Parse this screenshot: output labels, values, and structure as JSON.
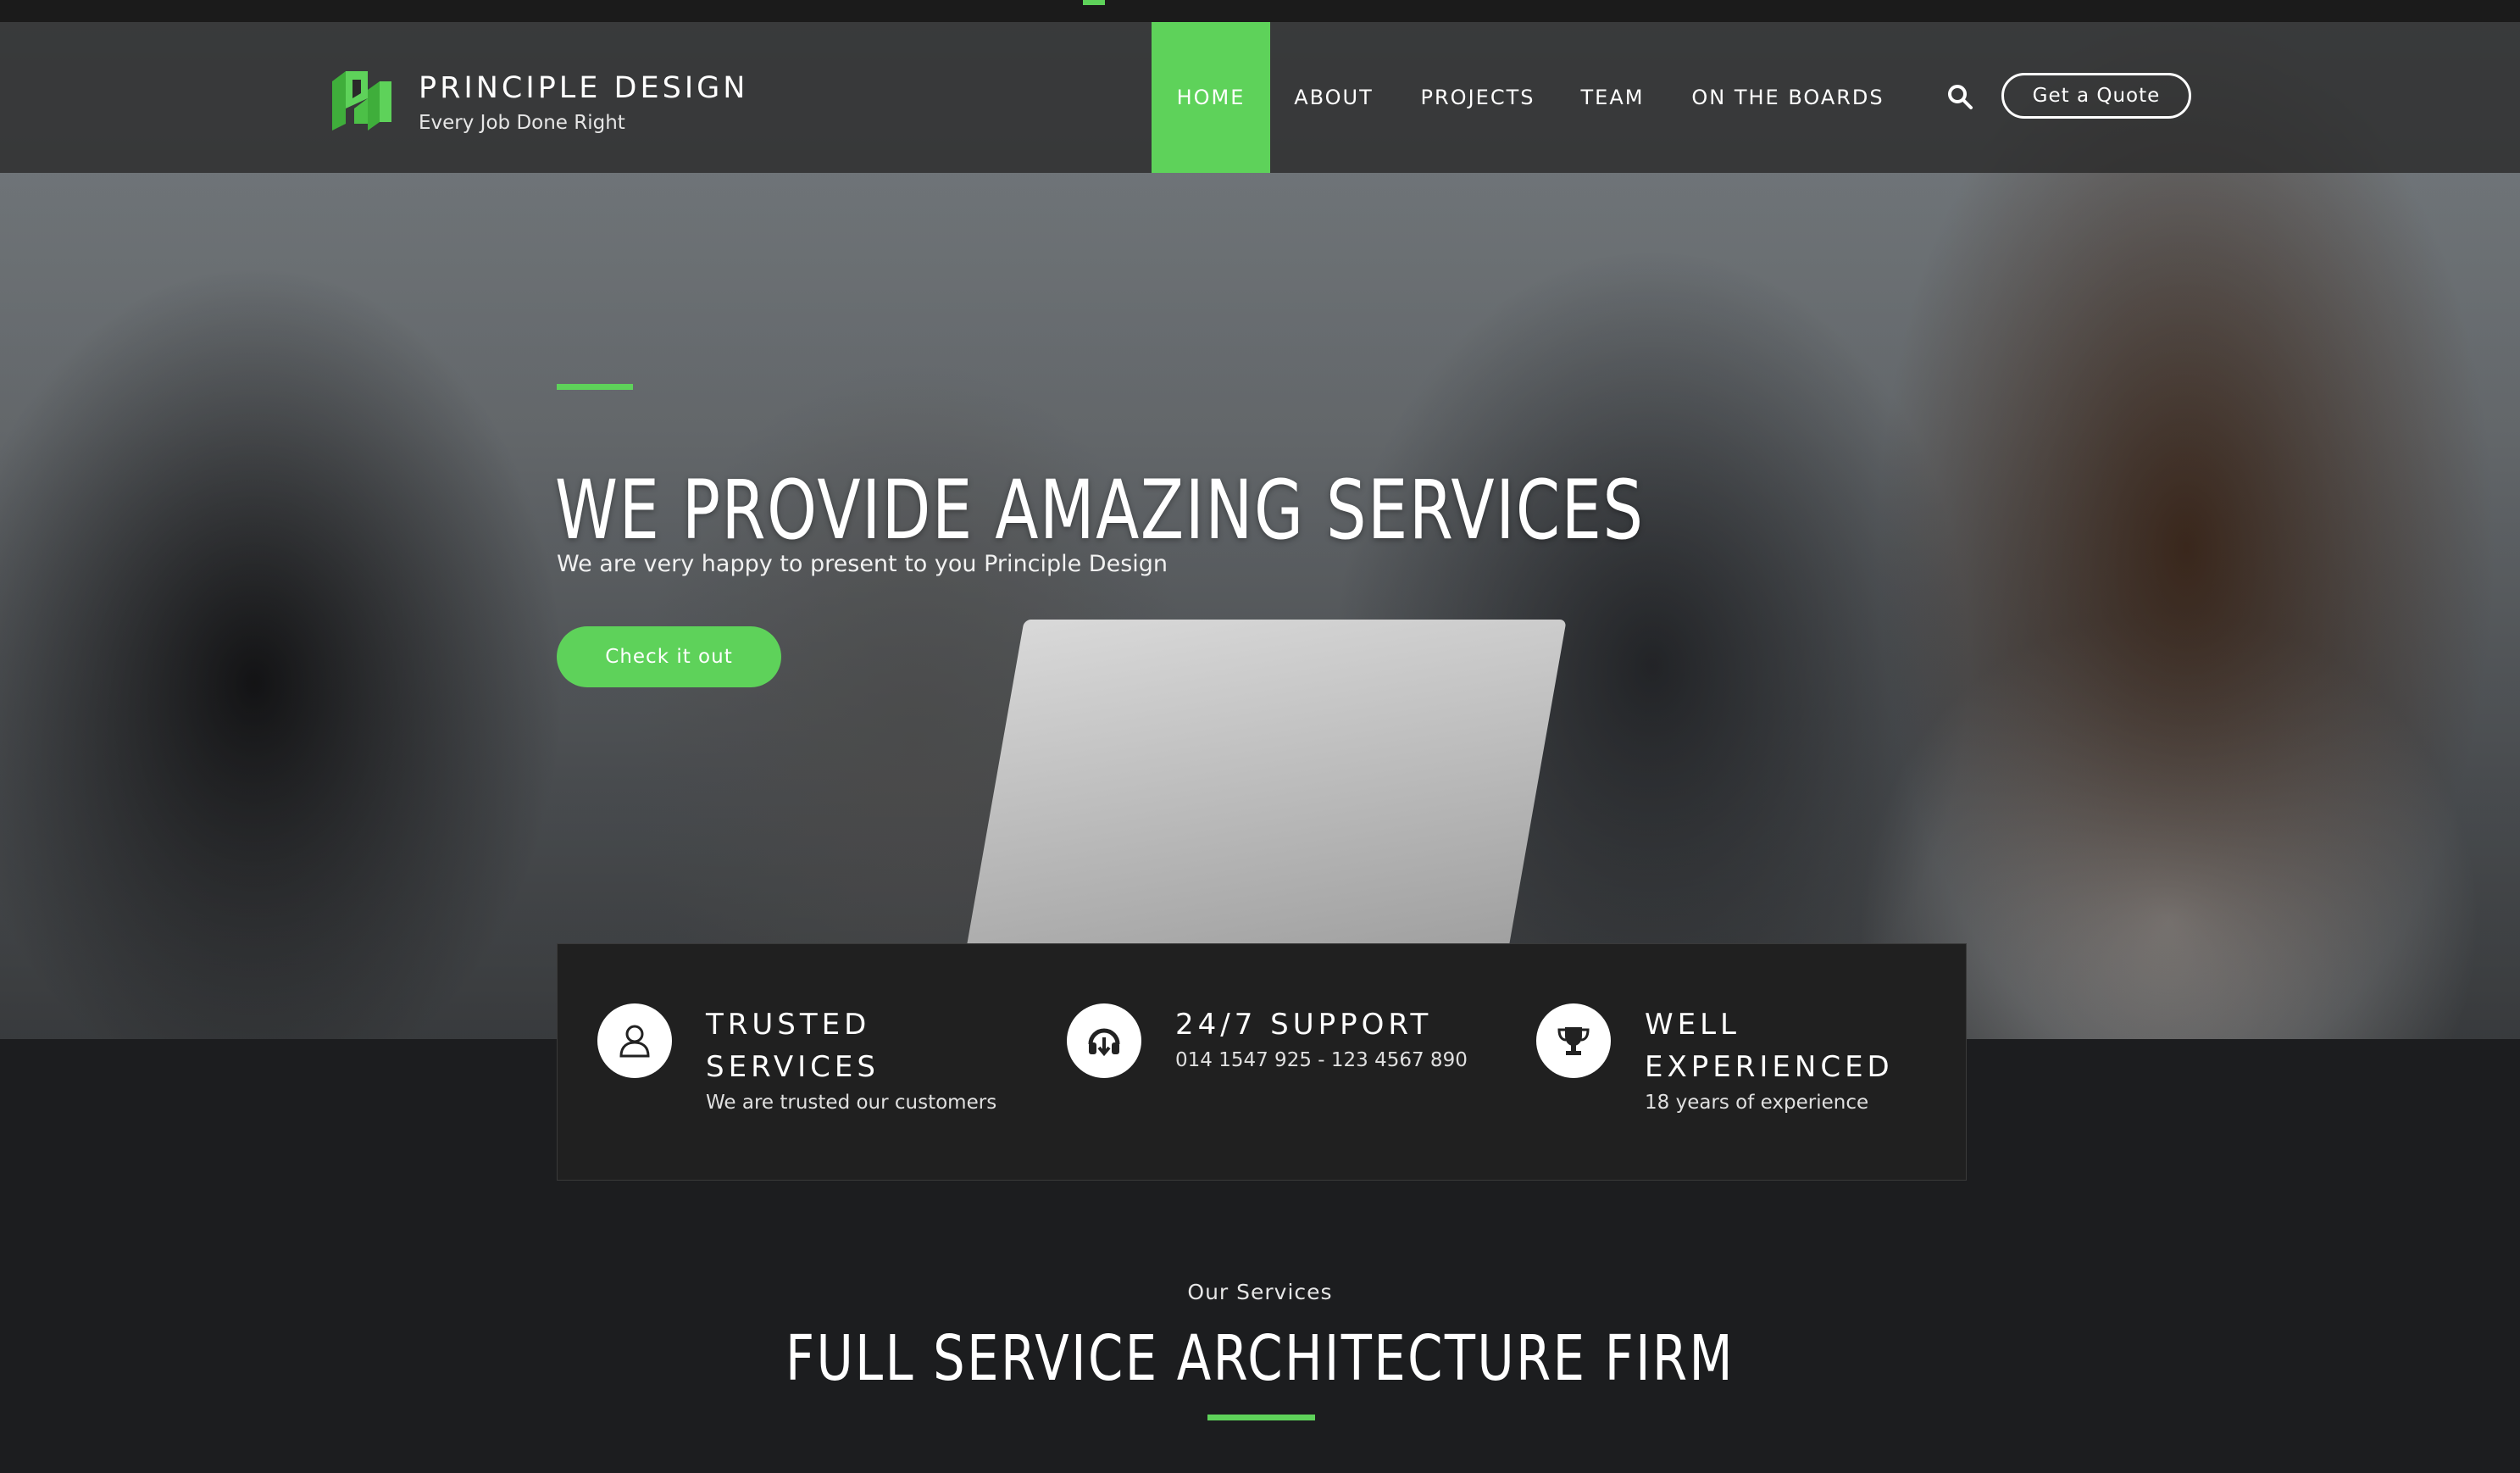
{
  "header": {
    "brand_name": "PRINCIPLE DESIGN",
    "tagline": "Every Job Done Right",
    "nav": [
      {
        "label": "HOME",
        "active": true
      },
      {
        "label": "ABOUT",
        "active": false
      },
      {
        "label": "PROJECTS",
        "active": false
      },
      {
        "label": "TEAM",
        "active": false
      },
      {
        "label": "ON THE BOARDS",
        "active": false
      }
    ],
    "quote_button": "Get a Quote"
  },
  "hero": {
    "title": "WE PROVIDE AMAZING SERVICES",
    "subtitle": "We are very happy to present to you Principle Design",
    "cta": "Check it out"
  },
  "features": [
    {
      "icon": "user-icon",
      "title": "TRUSTED SERVICES",
      "desc": "We are trusted our customers"
    },
    {
      "icon": "headset-icon",
      "title": "24/7 SUPPORT",
      "desc": "014 1547 925 - 123 4567 890"
    },
    {
      "icon": "trophy-icon",
      "title": "WELL EXPERIENCED",
      "desc": "18 years of experience"
    }
  ],
  "services": {
    "label": "Our Services",
    "title": "FULL SERVICE ARCHITECTURE FIRM"
  },
  "colors": {
    "accent": "#5ed25a",
    "background": "#1c1d1f",
    "header": "#282828"
  }
}
